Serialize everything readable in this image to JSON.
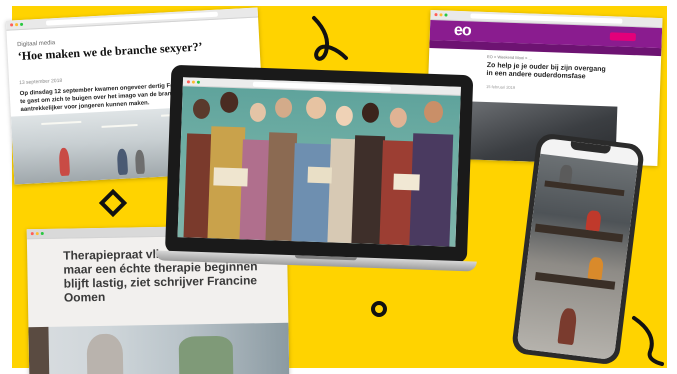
{
  "colors": {
    "background": "#ffd300",
    "eo_purple": "#8a1c8f",
    "eo_pink": "#e3007a"
  },
  "article_left": {
    "kicker": "Digitaal media",
    "title": "‘Hoe maken we de branche sexyer?’",
    "meta": "13 september 2018",
    "lead": "Op dinsdag 12 september kwamen ongeveer dertig Fontys-studenten bij Nowatex te gast om zich te buigen over het imago van de branche, en hoe we de branche aantrekkelijker voor jongeren kunnen maken."
  },
  "article_right": {
    "logo": "eo",
    "breadcrumb": "EO > Weekend Mooi > ...",
    "title": "Zo help je je ouder bij zijn overgang in een andere ouderdomsfase",
    "meta": "15 februari 2019"
  },
  "article_bottom": {
    "title": "Therapiepraat vliegt je om de oren, maar een échte therapie beginnen blijft lastig, ziet schrijver Francine Oomen"
  },
  "icons": [
    "squiggle-icon",
    "diamond-icon",
    "circle-icon",
    "curve-icon"
  ]
}
